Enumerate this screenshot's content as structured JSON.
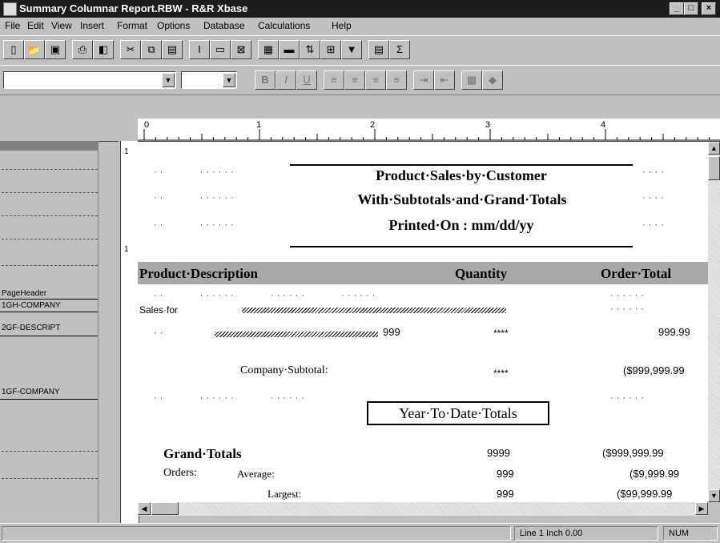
{
  "window": {
    "title": "Summary Columnar Report.RBW - R&R Xbase",
    "minimize": "_",
    "maximize": "□",
    "close": "×"
  },
  "menu": [
    "File",
    "Edit",
    "View",
    "Insert",
    "Format",
    "Options",
    "Database",
    "Calculations",
    "Help"
  ],
  "toolbar1": {
    "icons": [
      "new-icon",
      "open-icon",
      "save-icon",
      "print-icon",
      "print-preview-icon",
      "cut-icon",
      "copy-icon",
      "paste-icon",
      "insert-field-icon",
      "insert-box-icon",
      "insert-picture-icon",
      "table-icon",
      "band-icon",
      "sort-icon",
      "group-icon",
      "filter-icon",
      "calculator-icon",
      "sum-icon"
    ]
  },
  "toolbar2": {
    "font_name": "",
    "font_size": "",
    "bold": "B",
    "italic": "I",
    "underline": "U"
  },
  "ruler": {
    "numbers": [
      "0",
      "1",
      "2",
      "3",
      "4"
    ]
  },
  "bands": [
    "PageHeader",
    "1GH-COMPANY",
    "2GF-DESCRIPT",
    "1GF-COMPANY"
  ],
  "report": {
    "title_line1": "Product·Sales·by·Customer",
    "title_line2": "With·Subtotals·and·Grand·Totals",
    "title_line3": "Printed·On : mm/dd/yy",
    "col_product": "Product·Description",
    "col_quantity": "Quantity",
    "col_order_total": "Order·Total",
    "sales_for": "Sales·for",
    "desc_qty": "999",
    "desc_qty_mask": "****",
    "desc_amount": "999.99",
    "company_subtotal_label": "Company·Subtotal:",
    "company_subtotal_qty": "****",
    "company_subtotal_amount": "($999,999.99",
    "ytd_box": "Year·To·Date·Totals",
    "grand_totals_label": "Grand·Totals",
    "grand_totals_qty": "9999",
    "grand_totals_amount": "($999,999.99",
    "orders_label": "Orders:",
    "average_label": "Average:",
    "average_qty": "999",
    "average_amount": "($9,999.99",
    "largest_label": "Largest:",
    "largest_qty": "999",
    "largest_amount": "($99,999.99"
  },
  "status": {
    "position": "Line 1 Inch 0.00",
    "mode": "NUM"
  }
}
